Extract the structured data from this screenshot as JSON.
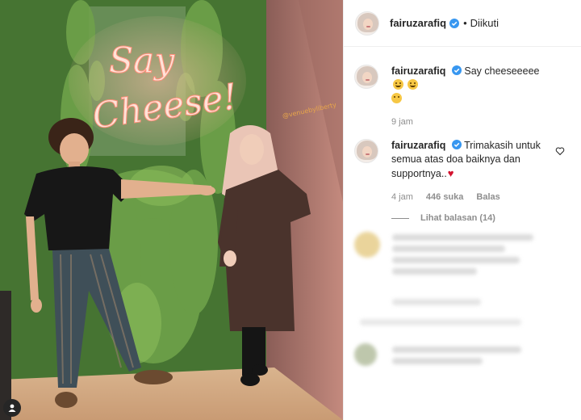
{
  "post": {
    "author": "fairuzarafiq",
    "follow_status": "Diikuti",
    "verified": true
  },
  "photo": {
    "neon_sign_line1": "Say",
    "neon_sign_line2": "Cheese!",
    "icons": {
      "user_tag": "user-tag-icon"
    }
  },
  "caption": {
    "username": "fairuzarafiq",
    "text": "Say cheeseeeee",
    "emojis": [
      "grinning-face",
      "hugging-face",
      "blowing-kiss-face"
    ],
    "time": "9 jam"
  },
  "comments": [
    {
      "username": "fairuzarafiq",
      "text": "Trimakasih untuk semua atas doa baiknya dan supportnya..",
      "emoji": "broken-heart",
      "time": "4 jam",
      "likes": "446 suka",
      "reply_label": "Balas",
      "view_replies": "Lihat balasan (14)"
    }
  ],
  "colors": {
    "accent_verified": "#3897f0",
    "secondary_text": "#8e8e8e",
    "neon": "#ffb3a1"
  }
}
